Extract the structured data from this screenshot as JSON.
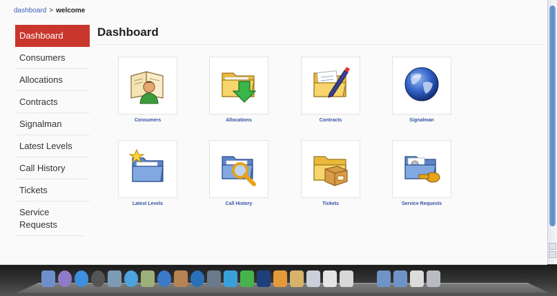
{
  "breadcrumb": {
    "link": "dashboard",
    "separator": ">",
    "current": "welcome"
  },
  "sidebar": {
    "items": [
      {
        "label": "Dashboard",
        "active": true
      },
      {
        "label": "Consumers"
      },
      {
        "label": "Allocations"
      },
      {
        "label": "Contracts"
      },
      {
        "label": "Signalman"
      },
      {
        "label": "Latest Levels"
      },
      {
        "label": "Call History"
      },
      {
        "label": "Tickets"
      },
      {
        "label": "Service Requests"
      }
    ]
  },
  "main": {
    "title": "Dashboard",
    "tiles": [
      {
        "label": "Consumers",
        "icon": "consumers-book-person-icon"
      },
      {
        "label": "Allocations",
        "icon": "allocations-folder-arrow-icon"
      },
      {
        "label": "Contracts",
        "icon": "contracts-folder-pen-icon"
      },
      {
        "label": "Signalman",
        "icon": "signalman-globe-icon"
      },
      {
        "label": "Latest Levels",
        "icon": "latest-levels-folder-star-icon"
      },
      {
        "label": "Call History",
        "icon": "call-history-folder-magnifier-icon"
      },
      {
        "label": "Tickets",
        "icon": "tickets-folder-box-icon"
      },
      {
        "label": "Service Requests",
        "icon": "service-requests-folder-key-icon"
      }
    ]
  },
  "colors": {
    "active_nav": "#c8362c",
    "link": "#3b5bb5",
    "tile_label": "#3553a6",
    "folder": "#f2c94c"
  }
}
